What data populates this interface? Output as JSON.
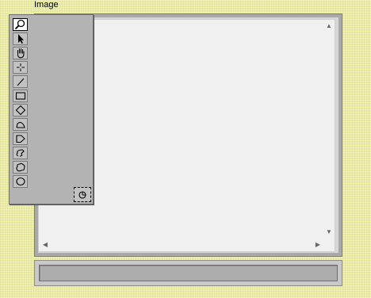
{
  "window": {
    "title": "Image"
  },
  "tools": [
    {
      "name": "zoom",
      "icon": "magnifier-icon",
      "selected": true
    },
    {
      "name": "select",
      "icon": "arrow-pointer-icon",
      "selected": false
    },
    {
      "name": "pan",
      "icon": "hand-icon",
      "selected": false
    },
    {
      "name": "crosshair",
      "icon": "crosshair-icon",
      "selected": false
    },
    {
      "name": "line",
      "icon": "line-icon",
      "selected": false
    },
    {
      "name": "rectangle",
      "icon": "rectangle-icon",
      "selected": false
    },
    {
      "name": "rotated-rectangle",
      "icon": "diamond-icon",
      "selected": false
    },
    {
      "name": "annulus",
      "icon": "annulus-icon",
      "selected": false
    },
    {
      "name": "polygon",
      "icon": "polygon-icon",
      "selected": false
    },
    {
      "name": "freehand",
      "icon": "freehand-icon",
      "selected": false
    },
    {
      "name": "freehand-region",
      "icon": "freehand-region-icon",
      "selected": false
    },
    {
      "name": "oval",
      "icon": "oval-icon",
      "selected": false
    }
  ],
  "color_tool": {
    "icon": "color-tool-icon"
  },
  "status_bar": {
    "text": ""
  }
}
